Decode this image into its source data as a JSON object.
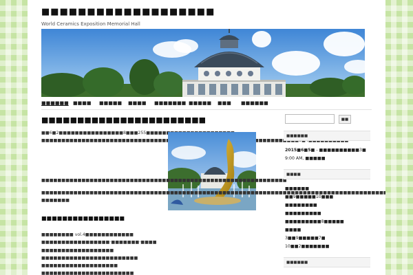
{
  "site": {
    "title": "■■■■■■■■■■■■■■■■■■■",
    "description": "World Ceramics Exposition Memorial Hall"
  },
  "nav": {
    "items": [
      "■■■■■■",
      "■■■■",
      "■■■■■",
      "■■■■",
      "■■■■■■■",
      "■■■■■",
      "■■■",
      "■■■■■■"
    ]
  },
  "post": {
    "title": "■■■■■■■■■■■■■■■■■■■■■■■",
    "paragraph1": "■■6■2■■■■■■■■■■■■■■■■8■■■255■■■■■■■■■■■■■■■■■■■■■■",
    "paragraph1b": "■■■■■■■■■■■■■■■■■■■■■■■■■■■■■■■■■■■■■■■■■■■■■■■■■■■■■■■■■■■■■■■■5■4■■■■■■■■■■",
    "paragraph2": "■■■■■■■■■■■■■■■■■■■■■■■■■■■■■■■■■■■■■■■■■■■■■■■■■■■■■■■■■■■■■",
    "paragraph3": "■■■■■■■■■■■■■■■■■■■■■■■■■■■■■■■■■■■■■■■■■■■■■■■■■■■■■■■■■■■■■■■■■■■■■■■■■■■■■■■■■■■■■■■ ■■■■■■■",
    "section_heading": "■■■■■■■■■■■■■■■■",
    "list": [
      "■■■■■■■■ vol.4■■■■■■■■■■■■",
      "■■■■■■■■■■■■■■■■■·■■■■■■■·■■■■",
      "■■■■■■■■■■■■■■■■■■",
      "■■■■■■■■■■■■■■■■■■■■■■■■",
      "■■■■■■■■■■■■■■■■■■■",
      "■■■■■■■■■■■■■■■■■■■■■■■"
    ]
  },
  "search": {
    "placeholder": "",
    "button_label": "■■"
  },
  "sidebar": {
    "widget1_title": "■■■■■■",
    "event_date": "2015■6■5■",
    "event_title": " - ■■■■■■■■■■3■",
    "event_time": "9:00 AM, ■■■■■",
    "widget2_title": "■■■■",
    "widget2_lines": [
      "■■■■■■",
      "■■9■■■■■10■■■",
      "■■■■■■■■",
      "■■■■■■■■■",
      "■■■■■■■■■8■■■■■",
      "■■■■",
      "3■■9■■■■■7■",
      "10■■2■■■■■■■"
    ],
    "widget3_title": "■■■■■■"
  }
}
